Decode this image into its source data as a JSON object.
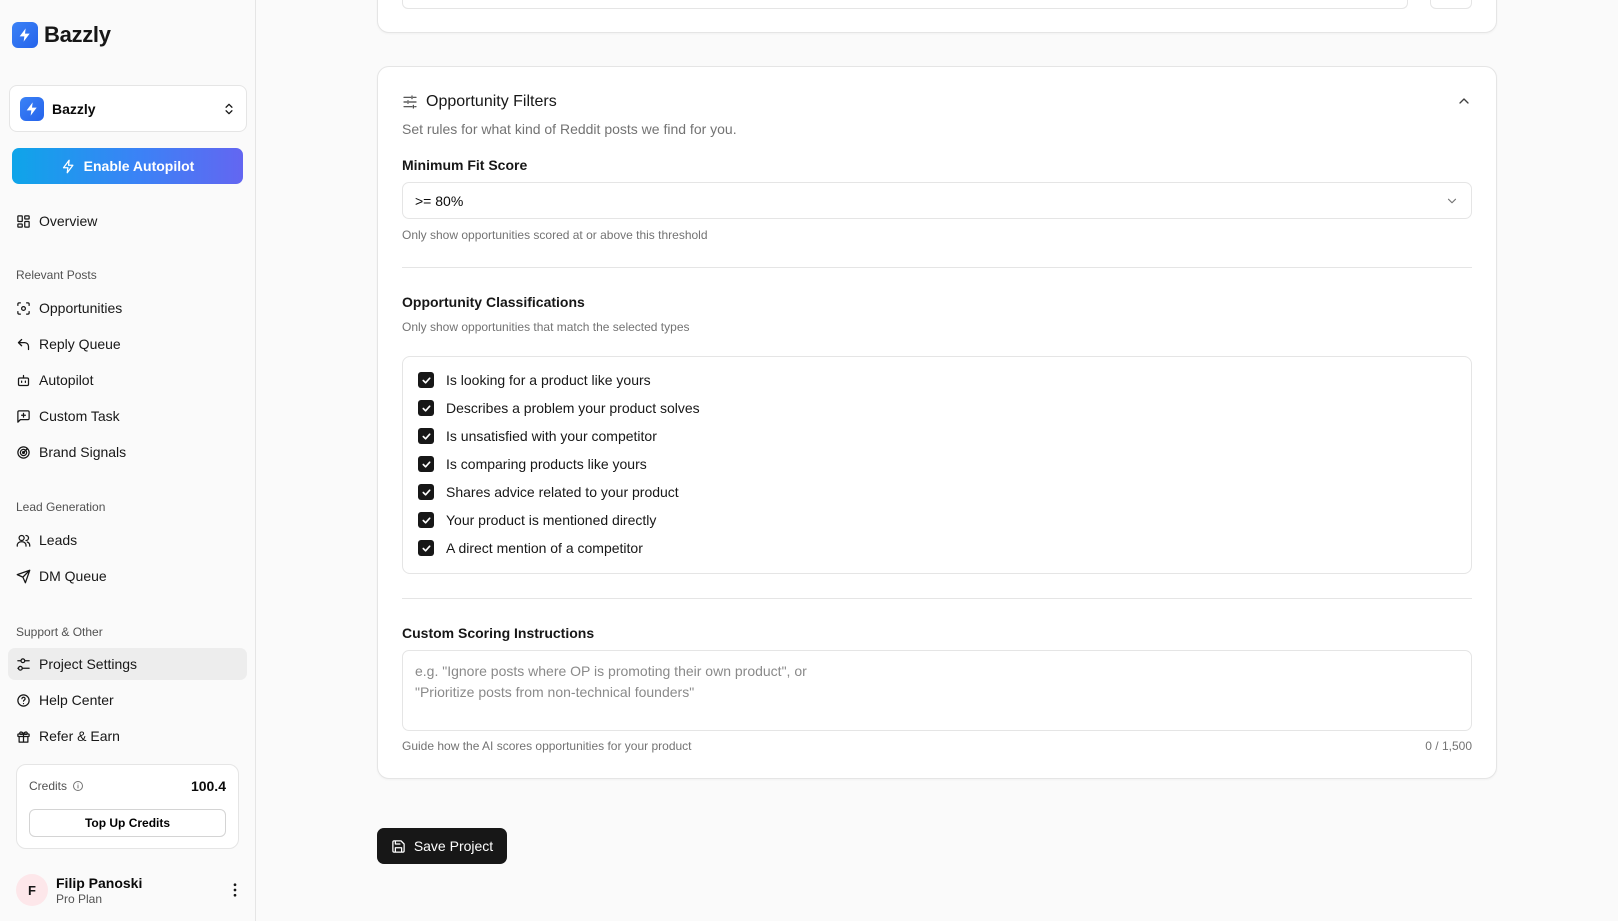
{
  "brand": {
    "name": "Bazzly",
    "logo_color": "#3b82f6"
  },
  "project_switcher": {
    "name": "Bazzly"
  },
  "autopilot_button": {
    "label": "Enable Autopilot"
  },
  "nav": {
    "overview": "Overview",
    "group_relevant": "Relevant Posts",
    "opportunities": "Opportunities",
    "reply_queue": "Reply Queue",
    "autopilot": "Autopilot",
    "custom_task": "Custom Task",
    "brand_signals": "Brand Signals",
    "group_leads": "Lead Generation",
    "leads": "Leads",
    "dm_queue": "DM Queue",
    "group_support": "Support & Other",
    "project_settings": "Project Settings",
    "help_center": "Help Center",
    "refer_earn": "Refer & Earn"
  },
  "credits": {
    "label": "Credits",
    "value": "100.4",
    "topup_label": "Top Up Credits"
  },
  "user": {
    "initial": "F",
    "name": "Filip Panoski",
    "plan": "Pro Plan"
  },
  "filters": {
    "title": "Opportunity Filters",
    "description": "Set rules for what kind of Reddit posts we find for you.",
    "min_fit": {
      "label": "Minimum Fit Score",
      "value": ">= 80%",
      "help": "Only show opportunities scored at or above this threshold"
    },
    "classifications": {
      "label": "Opportunity Classifications",
      "help": "Only show opportunities that match the selected types",
      "items": [
        "Is looking for a product like yours",
        "Describes a problem your product solves",
        "Is unsatisfied with your competitor",
        "Is comparing products like yours",
        "Shares advice related to your product",
        "Your product is mentioned directly",
        "A direct mention of a competitor"
      ]
    },
    "custom_scoring": {
      "label": "Custom Scoring Instructions",
      "placeholder": "e.g. \"Ignore posts where OP is promoting their own product\", or\n\"Prioritize posts from non-technical founders\"",
      "help": "Guide how the AI scores opportunities for your product",
      "counter": "0 / 1,500"
    }
  },
  "save_button": {
    "label": "Save Project"
  },
  "colors": {
    "accent": "#3b82f6",
    "primary_button": "#171717",
    "border": "#e5e5e5"
  }
}
